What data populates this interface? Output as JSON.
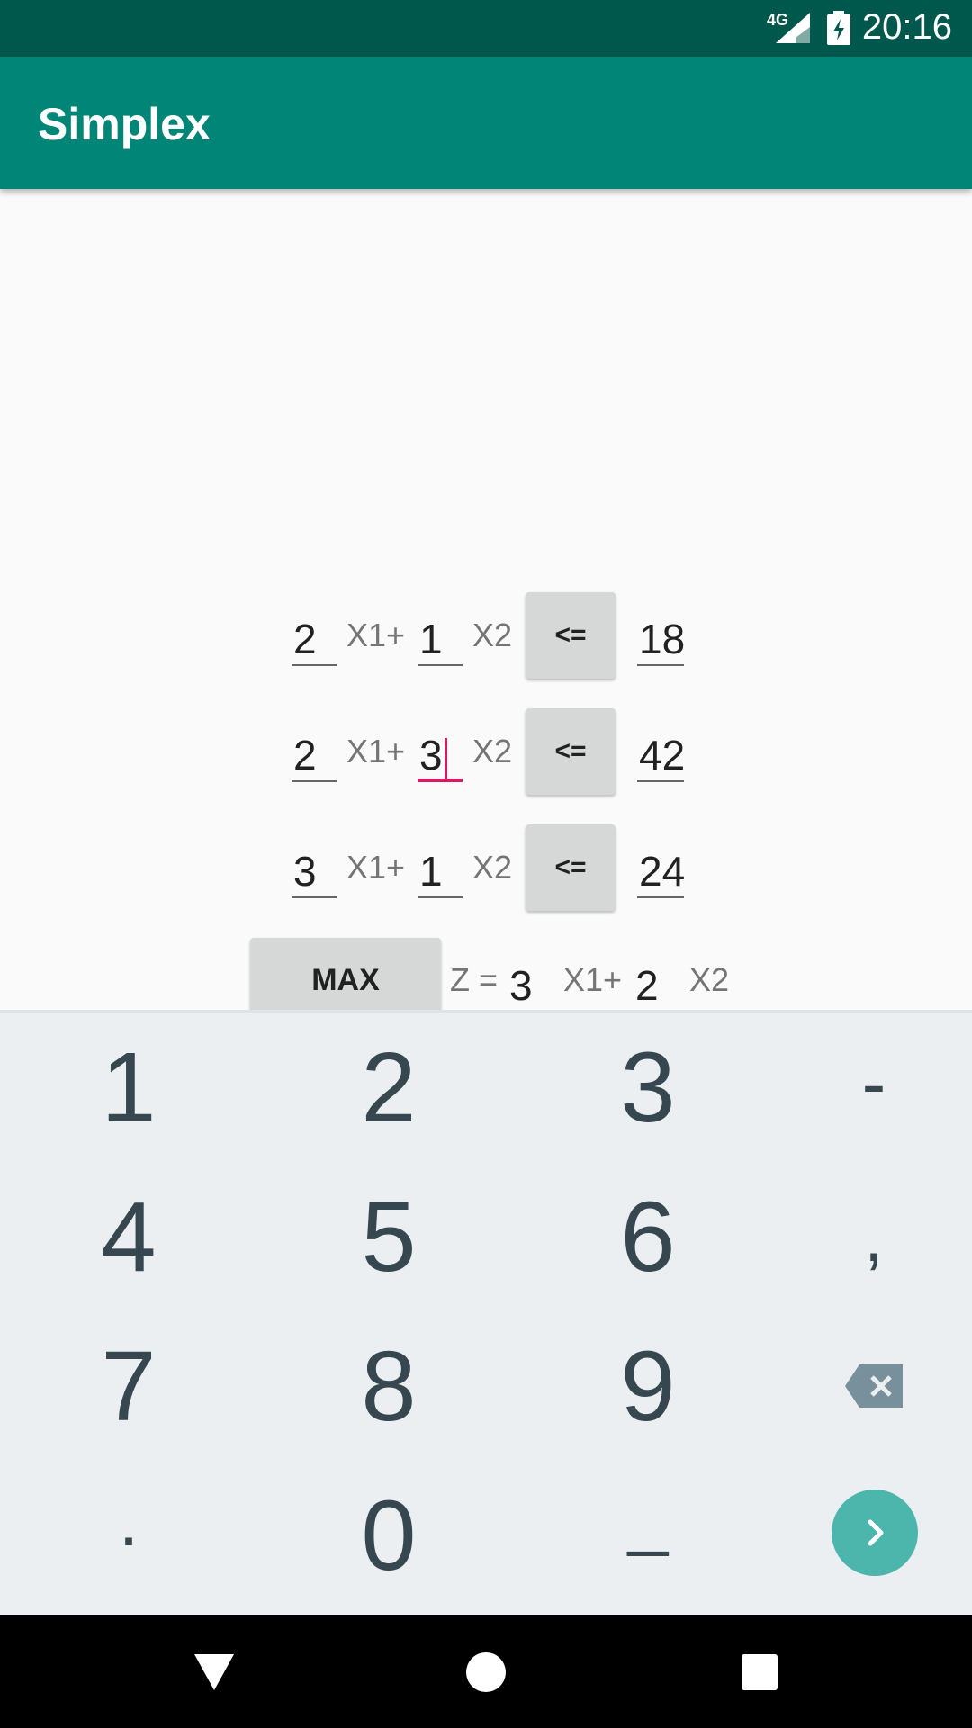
{
  "status_bar": {
    "network": "4G",
    "time": "20:16"
  },
  "app_bar": {
    "title": "Simplex"
  },
  "constraints": [
    {
      "a": "2",
      "x1_label": "X1+",
      "b": "1",
      "x2_label": "X2",
      "operator": "<=",
      "rhs": "18"
    },
    {
      "a": "2",
      "x1_label": "X1+",
      "b": "3",
      "x2_label": "X2",
      "operator": "<=",
      "rhs": "42"
    },
    {
      "a": "3",
      "x1_label": "X1+",
      "b": "1",
      "x2_label": "X2",
      "operator": "<=",
      "rhs": "24"
    }
  ],
  "objective": {
    "mode_label": "MAX",
    "z_label": "Z =",
    "c1": "3",
    "x1_label": "X1+",
    "c2": "2",
    "x2_label": "X2"
  },
  "keyboard": {
    "keys": [
      "1",
      "2",
      "3",
      "-",
      "4",
      "5",
      "6",
      ",",
      "7",
      "8",
      "9",
      ".",
      "0",
      "_"
    ]
  },
  "colors": {
    "app_bar": "#008577",
    "status_bar": "#00574b",
    "accent": "#d81b60",
    "enter_key": "#4db6ac"
  }
}
